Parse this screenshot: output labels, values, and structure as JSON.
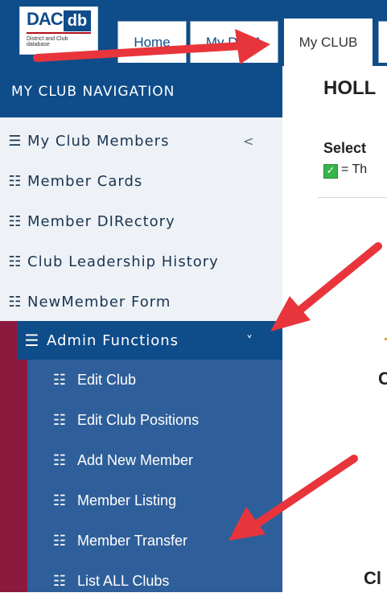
{
  "logo": {
    "dac": "DAC",
    "db": "db",
    "sub": "District and Club database"
  },
  "tabs": [
    {
      "label": "Home"
    },
    {
      "label": "My DATA"
    },
    {
      "label": "My CLUB"
    }
  ],
  "nav": {
    "header": "MY CLUB NAVIGATION",
    "items": [
      {
        "label": "My Club Members",
        "icon": "list-icon",
        "chevron": "<"
      },
      {
        "label": "Member Cards",
        "icon": "list-icon"
      },
      {
        "label": "Member DIRectory",
        "icon": "list-icon"
      },
      {
        "label": "Club Leadership History",
        "icon": "list-icon"
      },
      {
        "label": "NewMember Form",
        "icon": "list-icon"
      }
    ],
    "admin": {
      "label": "Admin Functions",
      "chevron": "˅",
      "items": [
        {
          "label": "Edit Club"
        },
        {
          "label": "Edit Club Positions"
        },
        {
          "label": "Add New Member"
        },
        {
          "label": "Member Listing"
        },
        {
          "label": "Member Transfer"
        },
        {
          "label": "List ALL Clubs"
        }
      ]
    }
  },
  "main": {
    "title": "HOLL",
    "select_text": "Select",
    "legend_text": "= Th",
    "c_letter": "C",
    "cl_letter": "Cl"
  },
  "colors": {
    "primary_blue": "#0f4c8a",
    "admin_blue": "#2f5f9a",
    "admin_accent": "#8c1a3f",
    "arrow_red": "#e8353b",
    "check_green": "#37b34a"
  }
}
